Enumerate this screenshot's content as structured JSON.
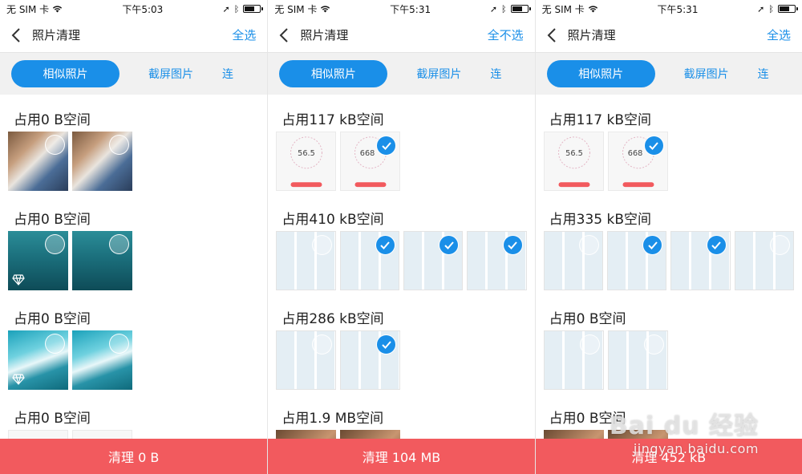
{
  "colors": {
    "accent": "#1a8fe8",
    "danger_bar": "#f25a5e",
    "tab_bg": "#f1f1f1"
  },
  "status": {
    "carrier": "无 SIM 卡",
    "times": [
      "下午5:03",
      "下午5:31",
      "下午5:31"
    ]
  },
  "nav": {
    "title": "照片清理",
    "actions": [
      "全选",
      "全不选",
      "全选"
    ]
  },
  "tabs": {
    "active": "相似照片",
    "second": "截屏图片",
    "third": "连"
  },
  "screens": [
    {
      "groups": [
        {
          "title": "占用0 B空间"
        },
        {
          "title": "占用0 B空间"
        },
        {
          "title": "占用0 B空间"
        },
        {
          "title": "占用0 B空间"
        }
      ],
      "bottom": "清理 0 B"
    },
    {
      "groups": [
        {
          "title": "占用117 kB空间"
        },
        {
          "title": "占用410 kB空间"
        },
        {
          "title": "占用286 kB空间"
        },
        {
          "title": "占用1.9 MB空间"
        }
      ],
      "thumb_text": {
        "storage_a": "56.5",
        "storage_b": "668"
      },
      "bottom": "清理 104 MB"
    },
    {
      "groups": [
        {
          "title": "占用117 kB空间"
        },
        {
          "title": "占用335 kB空间"
        },
        {
          "title": "占用0 B空间"
        },
        {
          "title": "占用0 B空间"
        }
      ],
      "thumb_text": {
        "storage_a": "56.5",
        "storage_b": "668"
      },
      "bottom": "清理 452 kB"
    }
  ],
  "watermark": {
    "logo": "Bai du 经验",
    "url": "jingyan.baidu.com"
  }
}
